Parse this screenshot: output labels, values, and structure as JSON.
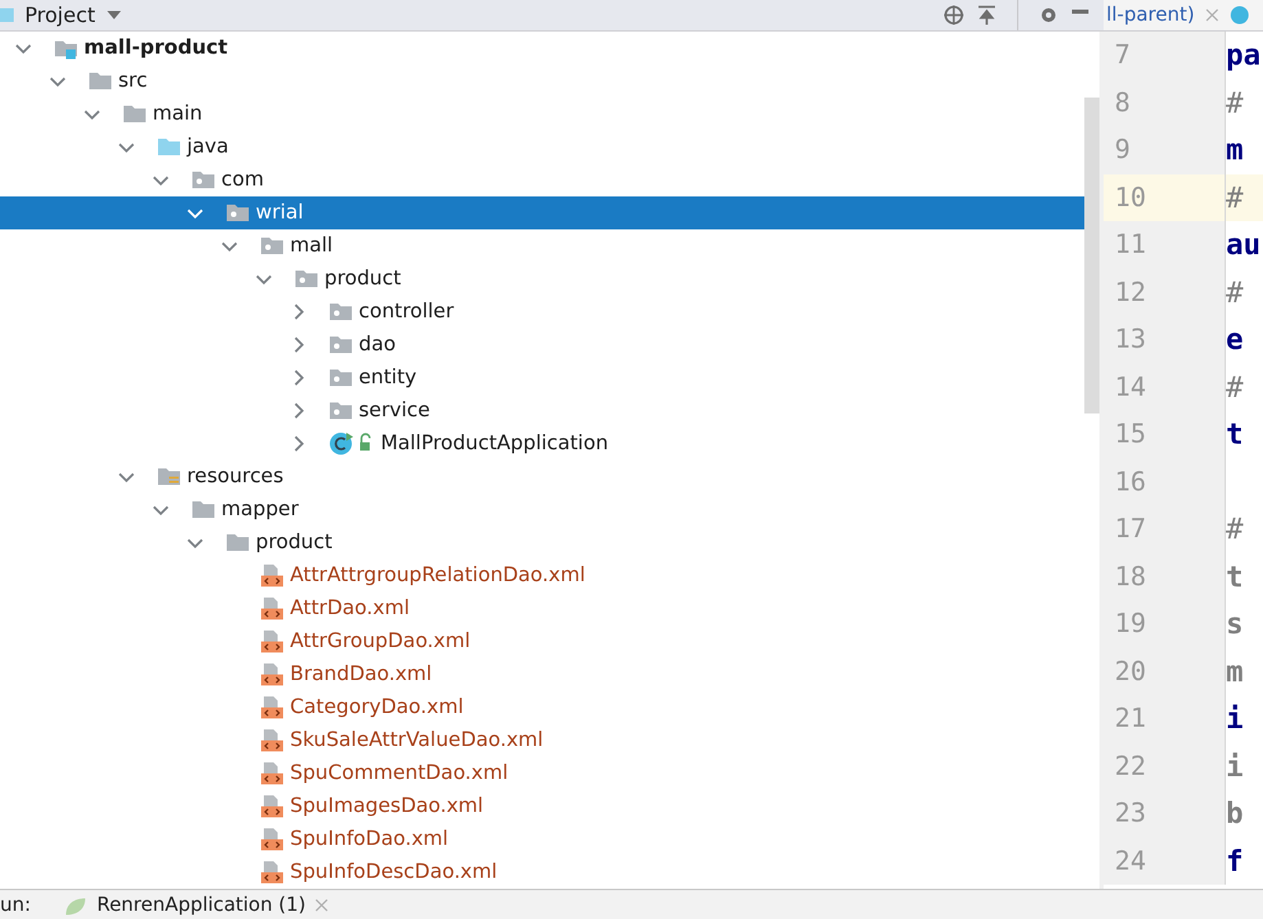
{
  "project_panel": {
    "title": "Project",
    "tree": [
      {
        "label": "mall-product",
        "kind": "module",
        "expanded": true,
        "selected": false,
        "children": [
          {
            "label": "src",
            "kind": "folder",
            "expanded": true,
            "selected": false,
            "children": [
              {
                "label": "main",
                "kind": "folder",
                "expanded": true,
                "selected": false,
                "children": [
                  {
                    "label": "java",
                    "kind": "source-folder",
                    "expanded": true,
                    "selected": false,
                    "children": [
                      {
                        "label": "com",
                        "kind": "package",
                        "expanded": true,
                        "selected": false,
                        "children": [
                          {
                            "label": "wrial",
                            "kind": "package",
                            "expanded": true,
                            "selected": true,
                            "children": [
                              {
                                "label": "mall",
                                "kind": "package",
                                "expanded": true,
                                "selected": false,
                                "children": [
                                  {
                                    "label": "product",
                                    "kind": "package",
                                    "expanded": true,
                                    "selected": false,
                                    "children": [
                                      {
                                        "label": "controller",
                                        "kind": "package",
                                        "expanded": false,
                                        "selected": false
                                      },
                                      {
                                        "label": "dao",
                                        "kind": "package",
                                        "expanded": false,
                                        "selected": false
                                      },
                                      {
                                        "label": "entity",
                                        "kind": "package",
                                        "expanded": false,
                                        "selected": false
                                      },
                                      {
                                        "label": "service",
                                        "kind": "package",
                                        "expanded": false,
                                        "selected": false
                                      },
                                      {
                                        "label": "MallProductApplication",
                                        "kind": "class",
                                        "expanded": false,
                                        "selected": false
                                      }
                                    ]
                                  }
                                ]
                              }
                            ]
                          }
                        ]
                      }
                    ]
                  },
                  {
                    "label": "resources",
                    "kind": "resources",
                    "expanded": true,
                    "selected": false,
                    "children": [
                      {
                        "label": "mapper",
                        "kind": "folder",
                        "expanded": true,
                        "selected": false,
                        "children": [
                          {
                            "label": "product",
                            "kind": "folder",
                            "expanded": true,
                            "selected": false,
                            "children": [
                              {
                                "label": "AttrAttrgroupRelationDao.xml",
                                "kind": "xml",
                                "selected": false
                              },
                              {
                                "label": "AttrDao.xml",
                                "kind": "xml",
                                "selected": false
                              },
                              {
                                "label": "AttrGroupDao.xml",
                                "kind": "xml",
                                "selected": false
                              },
                              {
                                "label": "BrandDao.xml",
                                "kind": "xml",
                                "selected": false
                              },
                              {
                                "label": "CategoryDao.xml",
                                "kind": "xml",
                                "selected": false
                              },
                              {
                                "label": "SkuSaleAttrValueDao.xml",
                                "kind": "xml",
                                "selected": false
                              },
                              {
                                "label": "SpuCommentDao.xml",
                                "kind": "xml",
                                "selected": false
                              },
                              {
                                "label": "SpuImagesDao.xml",
                                "kind": "xml",
                                "selected": false
                              },
                              {
                                "label": "SpuInfoDao.xml",
                                "kind": "xml",
                                "selected": false
                              },
                              {
                                "label": "SpuInfoDescDao.xml",
                                "kind": "xml",
                                "selected": false
                              }
                            ]
                          }
                        ]
                      }
                    ]
                  }
                ]
              }
            ]
          }
        ]
      }
    ]
  },
  "editor": {
    "tab": "ll-parent)",
    "lines": [
      {
        "number": "7",
        "code": "pa",
        "kind": "key",
        "current": false
      },
      {
        "number": "8",
        "code": "#",
        "kind": "comment",
        "current": false
      },
      {
        "number": "9",
        "code": "m",
        "kind": "key",
        "current": false
      },
      {
        "number": "10",
        "code": "#",
        "kind": "comment",
        "current": true
      },
      {
        "number": "11",
        "code": "au",
        "kind": "key",
        "current": false
      },
      {
        "number": "12",
        "code": "#",
        "kind": "comment",
        "current": false
      },
      {
        "number": "13",
        "code": "e",
        "kind": "key",
        "current": false
      },
      {
        "number": "14",
        "code": "#",
        "kind": "comment",
        "current": false
      },
      {
        "number": "15",
        "code": "t",
        "kind": "key",
        "current": false
      },
      {
        "number": "16",
        "current": false
      },
      {
        "number": "17",
        "code": "#",
        "kind": "comment",
        "current": false
      },
      {
        "number": "18",
        "code": "t",
        "kind": "inactive",
        "current": false
      },
      {
        "number": "19",
        "code": "s",
        "kind": "inactive",
        "current": false
      },
      {
        "number": "20",
        "code": "m",
        "kind": "inactive",
        "current": false
      },
      {
        "number": "21",
        "code": "i",
        "kind": "key",
        "current": false
      },
      {
        "number": "22",
        "code": "i",
        "kind": "inactive",
        "current": false
      },
      {
        "number": "23",
        "code": "b",
        "kind": "inactive",
        "current": false
      },
      {
        "number": "24",
        "code": "f",
        "kind": "key",
        "current": false
      }
    ]
  },
  "run_bar": {
    "label": "un:",
    "tab": "RenrenApplication (1)"
  }
}
